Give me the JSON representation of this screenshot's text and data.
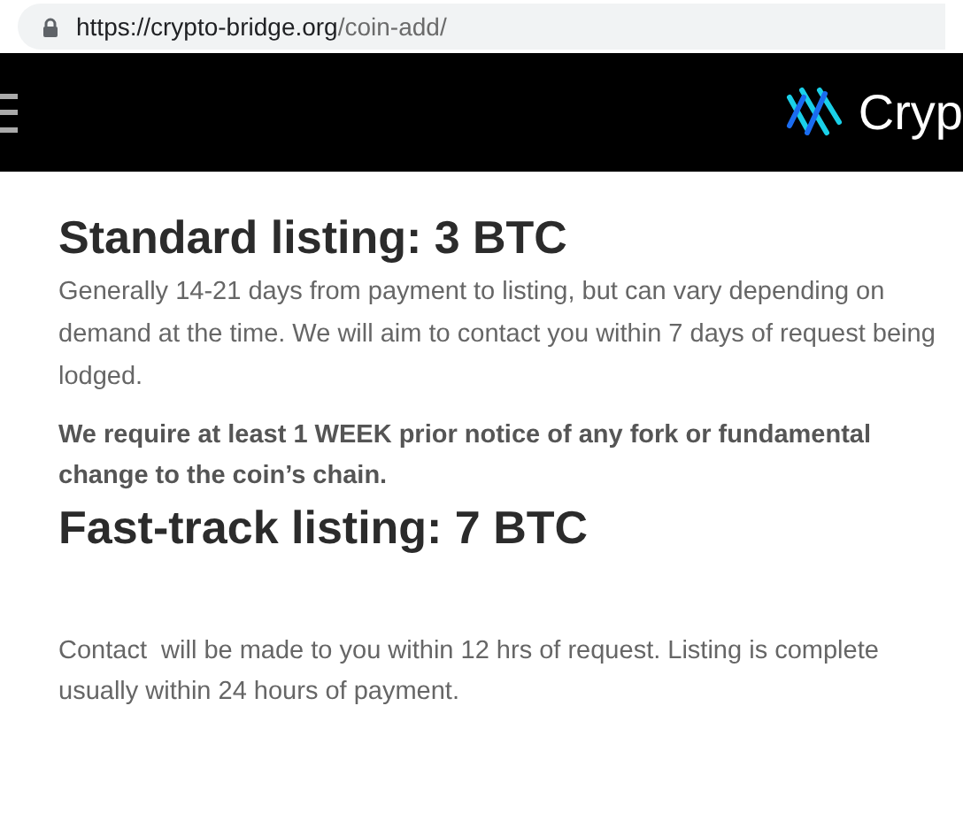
{
  "address_bar": {
    "url_host": "https://crypto-bridge.org",
    "url_path": "/coin-add/"
  },
  "header": {
    "logo_text": "Cryp"
  },
  "sections": [
    {
      "kind": "heading",
      "text": "Standard listing: 3 BTC"
    },
    {
      "kind": "paragraph",
      "text": "Generally 14-21 days from payment to listing, but can vary depending on demand at the time. We will aim to contact you within 7 days of request being lodged."
    },
    {
      "kind": "bold-paragraph",
      "text": "We require at least 1 WEEK prior notice of any fork or fundamental change to the coin’s chain."
    },
    {
      "kind": "heading",
      "text": "Fast-track listing: 7 BTC"
    },
    {
      "kind": "spaced-paragraph",
      "text": "Contact  will be made to you within 12 hrs of request. Listing is complete usually within 24 hours of payment."
    }
  ]
}
